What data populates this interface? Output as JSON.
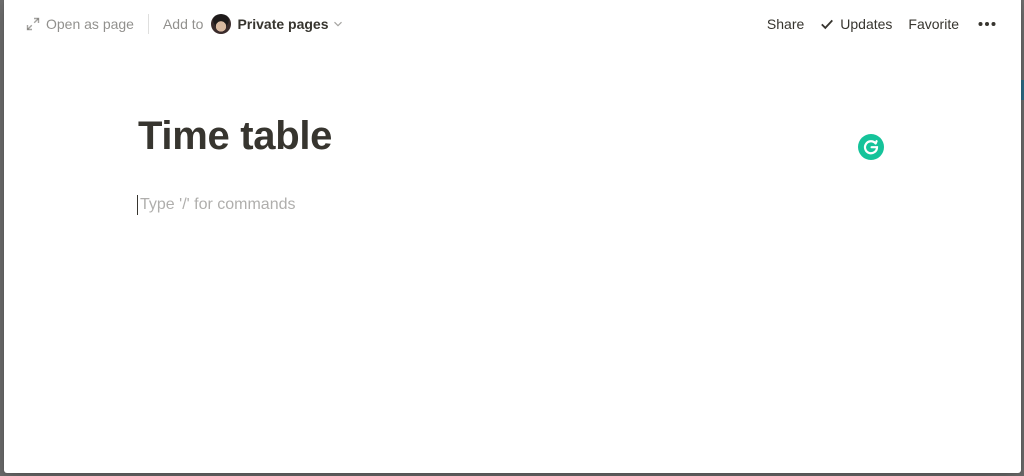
{
  "topbar": {
    "open_as_page": "Open as page",
    "add_to": "Add to",
    "workspace": "Private pages",
    "share": "Share",
    "updates": "Updates",
    "favorite": "Favorite"
  },
  "page": {
    "title": "Time table",
    "placeholder": "Type '/' for commands"
  },
  "colors": {
    "text": "#37352f",
    "grammarly": "#15c39a"
  },
  "icons": {
    "open": "open-in-full-icon",
    "chevron": "chevron-down-icon",
    "check": "check-icon",
    "more": "more-horizontal-icon",
    "grammarly": "grammarly-icon"
  }
}
